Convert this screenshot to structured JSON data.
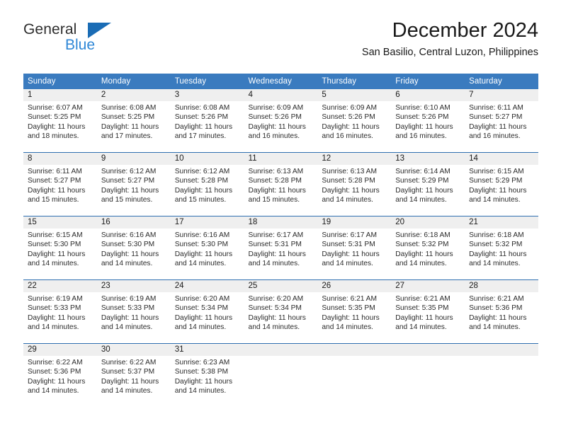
{
  "brand": {
    "name_part1": "General",
    "name_part2": "Blue",
    "triangle_color": "#1a6cb5",
    "blue_text_color": "#2f87d6"
  },
  "header": {
    "month_title": "December 2024",
    "location": "San Basilio, Central Luzon, Philippines",
    "accent_color": "#3a7bbf",
    "daynum_band_color": "#efefef"
  },
  "calendar": {
    "weekdays": [
      "Sunday",
      "Monday",
      "Tuesday",
      "Wednesday",
      "Thursday",
      "Friday",
      "Saturday"
    ],
    "weeks": [
      [
        {
          "day": "1",
          "sunrise": "Sunrise: 6:07 AM",
          "sunset": "Sunset: 5:25 PM",
          "daylight_1": "Daylight: 11 hours",
          "daylight_2": "and 18 minutes."
        },
        {
          "day": "2",
          "sunrise": "Sunrise: 6:08 AM",
          "sunset": "Sunset: 5:25 PM",
          "daylight_1": "Daylight: 11 hours",
          "daylight_2": "and 17 minutes."
        },
        {
          "day": "3",
          "sunrise": "Sunrise: 6:08 AM",
          "sunset": "Sunset: 5:26 PM",
          "daylight_1": "Daylight: 11 hours",
          "daylight_2": "and 17 minutes."
        },
        {
          "day": "4",
          "sunrise": "Sunrise: 6:09 AM",
          "sunset": "Sunset: 5:26 PM",
          "daylight_1": "Daylight: 11 hours",
          "daylight_2": "and 16 minutes."
        },
        {
          "day": "5",
          "sunrise": "Sunrise: 6:09 AM",
          "sunset": "Sunset: 5:26 PM",
          "daylight_1": "Daylight: 11 hours",
          "daylight_2": "and 16 minutes."
        },
        {
          "day": "6",
          "sunrise": "Sunrise: 6:10 AM",
          "sunset": "Sunset: 5:26 PM",
          "daylight_1": "Daylight: 11 hours",
          "daylight_2": "and 16 minutes."
        },
        {
          "day": "7",
          "sunrise": "Sunrise: 6:11 AM",
          "sunset": "Sunset: 5:27 PM",
          "daylight_1": "Daylight: 11 hours",
          "daylight_2": "and 16 minutes."
        }
      ],
      [
        {
          "day": "8",
          "sunrise": "Sunrise: 6:11 AM",
          "sunset": "Sunset: 5:27 PM",
          "daylight_1": "Daylight: 11 hours",
          "daylight_2": "and 15 minutes."
        },
        {
          "day": "9",
          "sunrise": "Sunrise: 6:12 AM",
          "sunset": "Sunset: 5:27 PM",
          "daylight_1": "Daylight: 11 hours",
          "daylight_2": "and 15 minutes."
        },
        {
          "day": "10",
          "sunrise": "Sunrise: 6:12 AM",
          "sunset": "Sunset: 5:28 PM",
          "daylight_1": "Daylight: 11 hours",
          "daylight_2": "and 15 minutes."
        },
        {
          "day": "11",
          "sunrise": "Sunrise: 6:13 AM",
          "sunset": "Sunset: 5:28 PM",
          "daylight_1": "Daylight: 11 hours",
          "daylight_2": "and 15 minutes."
        },
        {
          "day": "12",
          "sunrise": "Sunrise: 6:13 AM",
          "sunset": "Sunset: 5:28 PM",
          "daylight_1": "Daylight: 11 hours",
          "daylight_2": "and 14 minutes."
        },
        {
          "day": "13",
          "sunrise": "Sunrise: 6:14 AM",
          "sunset": "Sunset: 5:29 PM",
          "daylight_1": "Daylight: 11 hours",
          "daylight_2": "and 14 minutes."
        },
        {
          "day": "14",
          "sunrise": "Sunrise: 6:15 AM",
          "sunset": "Sunset: 5:29 PM",
          "daylight_1": "Daylight: 11 hours",
          "daylight_2": "and 14 minutes."
        }
      ],
      [
        {
          "day": "15",
          "sunrise": "Sunrise: 6:15 AM",
          "sunset": "Sunset: 5:30 PM",
          "daylight_1": "Daylight: 11 hours",
          "daylight_2": "and 14 minutes."
        },
        {
          "day": "16",
          "sunrise": "Sunrise: 6:16 AM",
          "sunset": "Sunset: 5:30 PM",
          "daylight_1": "Daylight: 11 hours",
          "daylight_2": "and 14 minutes."
        },
        {
          "day": "17",
          "sunrise": "Sunrise: 6:16 AM",
          "sunset": "Sunset: 5:30 PM",
          "daylight_1": "Daylight: 11 hours",
          "daylight_2": "and 14 minutes."
        },
        {
          "day": "18",
          "sunrise": "Sunrise: 6:17 AM",
          "sunset": "Sunset: 5:31 PM",
          "daylight_1": "Daylight: 11 hours",
          "daylight_2": "and 14 minutes."
        },
        {
          "day": "19",
          "sunrise": "Sunrise: 6:17 AM",
          "sunset": "Sunset: 5:31 PM",
          "daylight_1": "Daylight: 11 hours",
          "daylight_2": "and 14 minutes."
        },
        {
          "day": "20",
          "sunrise": "Sunrise: 6:18 AM",
          "sunset": "Sunset: 5:32 PM",
          "daylight_1": "Daylight: 11 hours",
          "daylight_2": "and 14 minutes."
        },
        {
          "day": "21",
          "sunrise": "Sunrise: 6:18 AM",
          "sunset": "Sunset: 5:32 PM",
          "daylight_1": "Daylight: 11 hours",
          "daylight_2": "and 14 minutes."
        }
      ],
      [
        {
          "day": "22",
          "sunrise": "Sunrise: 6:19 AM",
          "sunset": "Sunset: 5:33 PM",
          "daylight_1": "Daylight: 11 hours",
          "daylight_2": "and 14 minutes."
        },
        {
          "day": "23",
          "sunrise": "Sunrise: 6:19 AM",
          "sunset": "Sunset: 5:33 PM",
          "daylight_1": "Daylight: 11 hours",
          "daylight_2": "and 14 minutes."
        },
        {
          "day": "24",
          "sunrise": "Sunrise: 6:20 AM",
          "sunset": "Sunset: 5:34 PM",
          "daylight_1": "Daylight: 11 hours",
          "daylight_2": "and 14 minutes."
        },
        {
          "day": "25",
          "sunrise": "Sunrise: 6:20 AM",
          "sunset": "Sunset: 5:34 PM",
          "daylight_1": "Daylight: 11 hours",
          "daylight_2": "and 14 minutes."
        },
        {
          "day": "26",
          "sunrise": "Sunrise: 6:21 AM",
          "sunset": "Sunset: 5:35 PM",
          "daylight_1": "Daylight: 11 hours",
          "daylight_2": "and 14 minutes."
        },
        {
          "day": "27",
          "sunrise": "Sunrise: 6:21 AM",
          "sunset": "Sunset: 5:35 PM",
          "daylight_1": "Daylight: 11 hours",
          "daylight_2": "and 14 minutes."
        },
        {
          "day": "28",
          "sunrise": "Sunrise: 6:21 AM",
          "sunset": "Sunset: 5:36 PM",
          "daylight_1": "Daylight: 11 hours",
          "daylight_2": "and 14 minutes."
        }
      ],
      [
        {
          "day": "29",
          "sunrise": "Sunrise: 6:22 AM",
          "sunset": "Sunset: 5:36 PM",
          "daylight_1": "Daylight: 11 hours",
          "daylight_2": "and 14 minutes."
        },
        {
          "day": "30",
          "sunrise": "Sunrise: 6:22 AM",
          "sunset": "Sunset: 5:37 PM",
          "daylight_1": "Daylight: 11 hours",
          "daylight_2": "and 14 minutes."
        },
        {
          "day": "31",
          "sunrise": "Sunrise: 6:23 AM",
          "sunset": "Sunset: 5:38 PM",
          "daylight_1": "Daylight: 11 hours",
          "daylight_2": "and 14 minutes."
        },
        {
          "day": "",
          "sunrise": "",
          "sunset": "",
          "daylight_1": "",
          "daylight_2": ""
        },
        {
          "day": "",
          "sunrise": "",
          "sunset": "",
          "daylight_1": "",
          "daylight_2": ""
        },
        {
          "day": "",
          "sunrise": "",
          "sunset": "",
          "daylight_1": "",
          "daylight_2": ""
        },
        {
          "day": "",
          "sunrise": "",
          "sunset": "",
          "daylight_1": "",
          "daylight_2": ""
        }
      ]
    ]
  }
}
